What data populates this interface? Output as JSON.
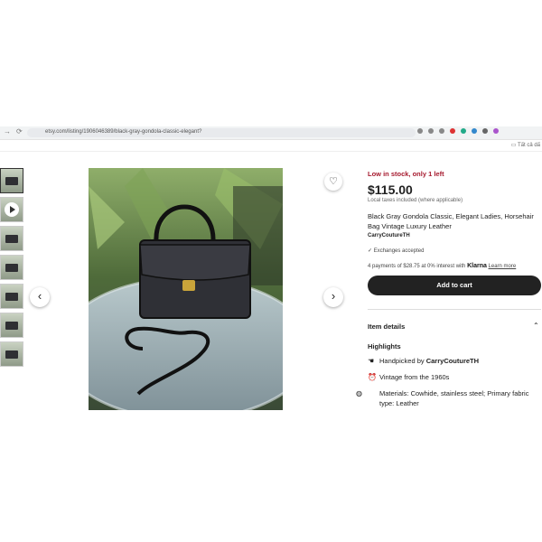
{
  "browser": {
    "url": "etsy.com/listing/1906046389/black-gray-gondola-classic-elegant?",
    "bookmark": "Tất cả dấ"
  },
  "listing": {
    "stock": "Low in stock, only 1 left",
    "price": "$115.00",
    "tax_note": "Local taxes included (where applicable)",
    "title": "Black Gray Gondola Classic, Elegant Ladies, Horsehair Bag Vintage Luxury Leather",
    "seller": "CarryCoutureTH",
    "exchanges": "Exchanges accepted",
    "klarna_text": "4 payments of $28.75 at 0% interest with",
    "klarna_brand": "Klarna",
    "learn_more": "Learn more",
    "add_to_cart": "Add to cart"
  },
  "details": {
    "header": "Item details",
    "highlights_title": "Highlights",
    "handpicked_prefix": "Handpicked by",
    "handpicked_by": "CarryCoutureTH",
    "vintage": "Vintage from the 1960s",
    "materials": "Materials: Cowhide, stainless steel; Primary fabric type: Leather"
  },
  "colors": {
    "accent": "#a61a2e",
    "button": "#222222"
  }
}
